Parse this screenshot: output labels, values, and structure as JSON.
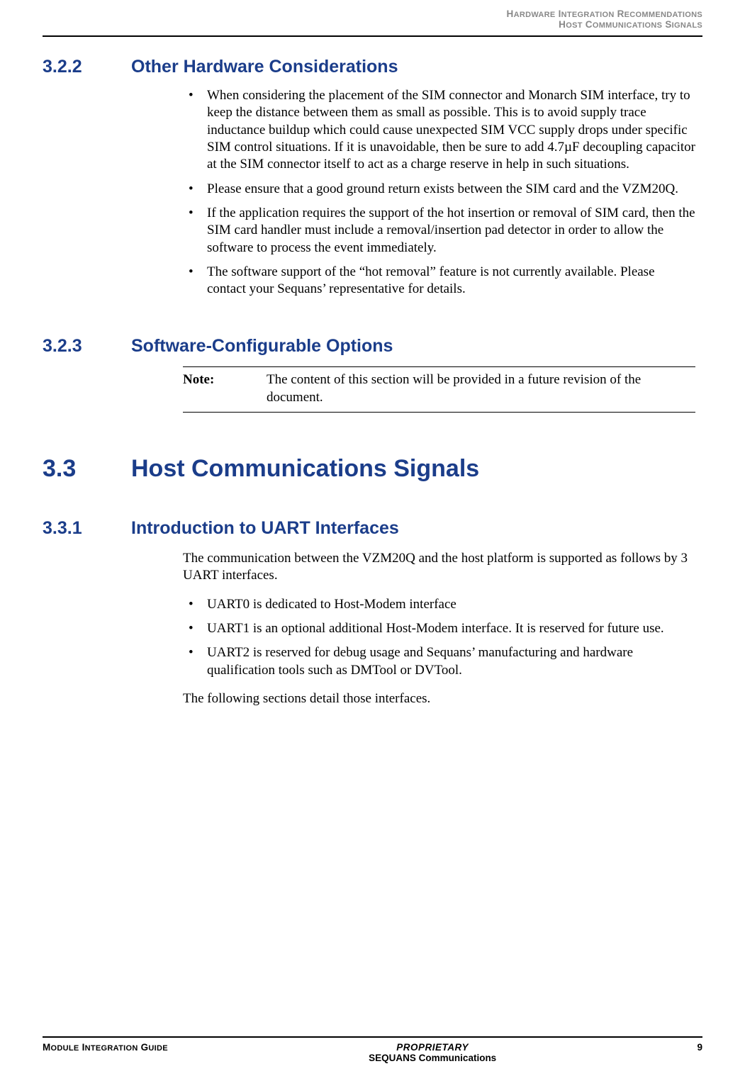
{
  "header": {
    "line1_a": "H",
    "line1_b": "ARDWARE",
    "line1_c": " I",
    "line1_d": "NTEGRATION",
    "line1_e": " R",
    "line1_f": "ECOMMENDATIONS",
    "line2_a": "H",
    "line2_b": "OST",
    "line2_c": " C",
    "line2_d": "OMMUNICATIONS",
    "line2_e": " S",
    "line2_f": "IGNALS"
  },
  "sec322": {
    "num": "3.2.2",
    "title": "Other Hardware Considerations",
    "bullets": [
      "When considering the placement of the SIM connector and Monarch SIM interface, try to keep the distance between them as small as possible. This is to avoid supply trace inductance buildup which could cause unexpected SIM VCC supply drops under specific SIM control situations. If it is unavoidable, then be sure to add 4.7µF decoupling capacitor at the SIM connector itself to act as a charge reserve in help in such situations.",
      "Please ensure that a good ground return exists between the SIM card and the VZM20Q.",
      "If the application requires the support of the hot insertion or removal of SIM card, then the SIM card handler must include a removal/insertion pad detector in order to allow the software to process the event immediately.",
      "The software support of the “hot removal” feature is not currently available. Please contact your Sequans’ representative for details."
    ]
  },
  "sec323": {
    "num": "3.2.3",
    "title": "Software-Configurable Options",
    "note_label": "Note:",
    "note_text": "The content of this section will be provided in a future revision of the document."
  },
  "sec33": {
    "num": "3.3",
    "title": "Host Communications Signals"
  },
  "sec331": {
    "num": "3.3.1",
    "title": "Introduction to UART Interfaces",
    "intro": "The communication between the VZM20Q and the host platform is supported as follows by 3 UART interfaces.",
    "bullets": [
      "UART0 is dedicated to Host-Modem interface",
      "UART1 is an optional additional Host-Modem interface. It is reserved for future use.",
      "UART2 is reserved for debug usage and Sequans’ manufacturing and hardware qualification tools such as DMTool or DVTool."
    ],
    "outro": "The following sections detail those interfaces."
  },
  "footer": {
    "left_a": "M",
    "left_b": "ODULE",
    "left_c": " I",
    "left_d": "NTEGRATION",
    "left_e": " G",
    "left_f": "UIDE",
    "center_prop": "PROPRIETARY",
    "center_company": "SEQUANS Communications",
    "page": "9"
  }
}
